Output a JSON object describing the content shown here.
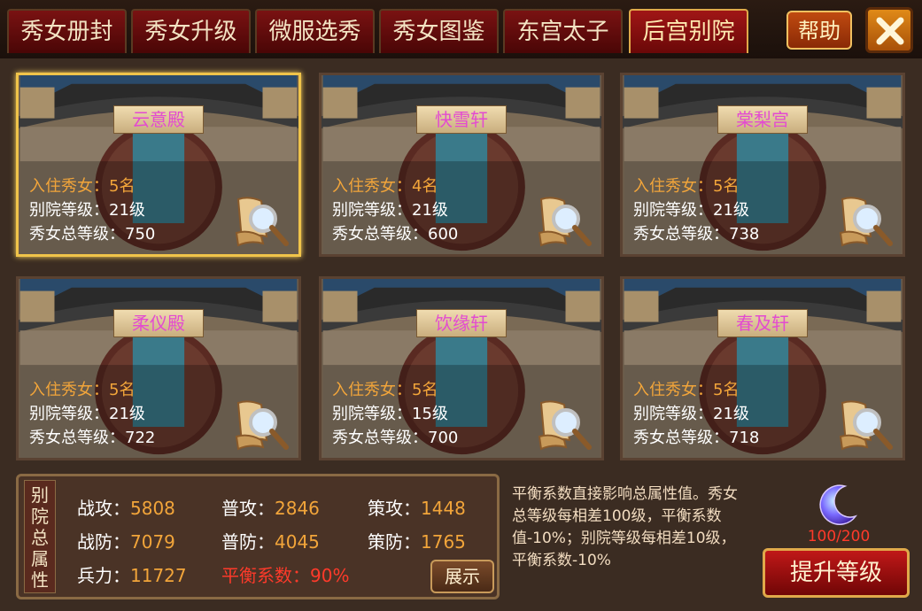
{
  "tabs": [
    {
      "label": "秀女册封"
    },
    {
      "label": "秀女升级"
    },
    {
      "label": "微服选秀"
    },
    {
      "label": "秀女图鉴"
    },
    {
      "label": "东宫太子"
    },
    {
      "label": "后宫别院"
    }
  ],
  "active_tab": "后宫别院",
  "help_label": "帮助",
  "courtyards": [
    {
      "name": "云意殿",
      "residents": "入住秀女：5名",
      "level": "别院等级：21级",
      "total_level": "秀女总等级：750",
      "selected": true
    },
    {
      "name": "快雪轩",
      "residents": "入住秀女：4名",
      "level": "别院等级：21级",
      "total_level": "秀女总等级：600",
      "selected": false
    },
    {
      "name": "棠梨宫",
      "residents": "入住秀女：5名",
      "level": "别院等级：21级",
      "total_level": "秀女总等级：738",
      "selected": false
    },
    {
      "name": "柔仪殿",
      "residents": "入住秀女：5名",
      "level": "别院等级：21级",
      "total_level": "秀女总等级：722",
      "selected": false
    },
    {
      "name": "饮缘轩",
      "residents": "入住秀女：5名",
      "level": "别院等级：15级",
      "total_level": "秀女总等级：700",
      "selected": false
    },
    {
      "name": "春及轩",
      "residents": "入住秀女：5名",
      "level": "别院等级：21级",
      "total_level": "秀女总等级：718",
      "selected": false
    }
  ],
  "attributes": {
    "title": "别院总属性",
    "items": [
      {
        "label": "战攻：",
        "value": "5808"
      },
      {
        "label": "普攻：",
        "value": "2846"
      },
      {
        "label": "策攻：",
        "value": "1448"
      },
      {
        "label": "战防：",
        "value": "7079"
      },
      {
        "label": "普防：",
        "value": "4045"
      },
      {
        "label": "策防：",
        "value": "1765"
      },
      {
        "label": "兵力：",
        "value": "11727"
      },
      {
        "label": "平衡系数：",
        "value": "90%"
      }
    ],
    "show_label": "展示"
  },
  "description": "平衡系数直接影响总属性值。秀女总等级每相差100级，平衡系数值-10%；别院等级每相差10级，平衡系数-10%",
  "item": {
    "icon": "crescent-moon-icon",
    "count": "100/200"
  },
  "upgrade_label": "提升等级"
}
